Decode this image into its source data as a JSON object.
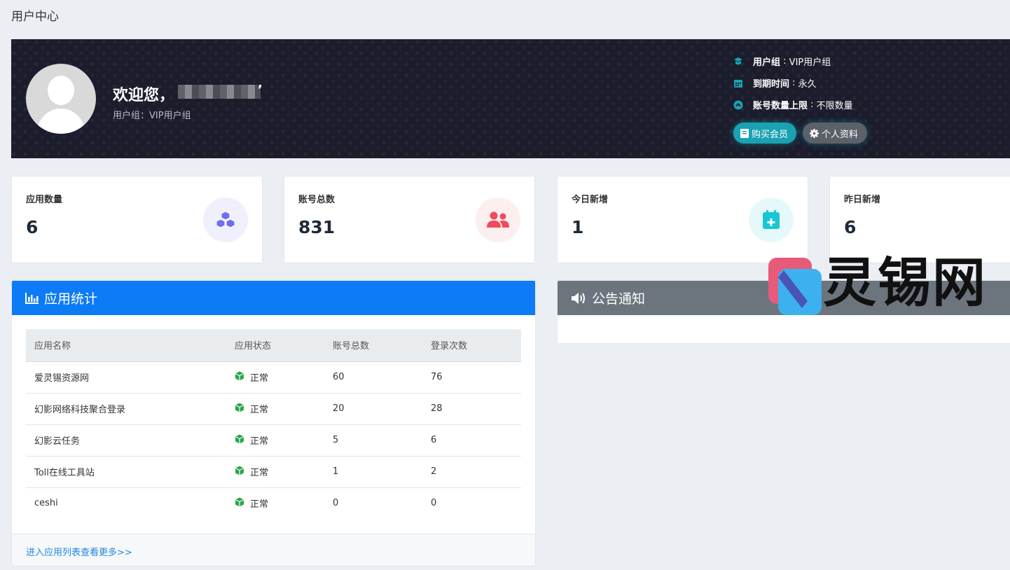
{
  "page": {
    "title": "用户中心"
  },
  "hero": {
    "welcome": "欢迎您，",
    "name_tail": "’",
    "usergroup_line": "用户组：VIP用户组",
    "info": [
      {
        "icon": "graduation-cap-icon",
        "label": "用户组",
        "sep": " : ",
        "value": "VIP用户组"
      },
      {
        "icon": "calendar-icon",
        "label": "到期时间",
        "sep": " : ",
        "value": "永久"
      },
      {
        "icon": "chevron-up-circle-icon",
        "label": "账号数量上限",
        "sep": " : ",
        "value": "不限数量"
      }
    ],
    "buttons": {
      "buy": "购买会员",
      "profile": "个人资料"
    }
  },
  "stats": [
    {
      "label": "应用数量",
      "value": "6",
      "icon": "cubes-icon",
      "color": "#6d6ff0",
      "bg": "#efeffd"
    },
    {
      "label": "账号总数",
      "value": "831",
      "icon": "users-icon",
      "color": "#ef4b5a",
      "bg": "#fdeeef"
    },
    {
      "label": "今日新增",
      "value": "1",
      "icon": "calendar-plus-icon",
      "color": "#19c6d6",
      "bg": "#e5f9fb"
    },
    {
      "label": "昨日新增",
      "value": "6"
    }
  ],
  "apps_panel": {
    "title": "应用统计",
    "columns": [
      "应用名称",
      "应用状态",
      "账号总数",
      "登录次数"
    ],
    "rows": [
      {
        "name": "爱灵锡资源网",
        "status": "正常",
        "accounts": "60",
        "logins": "76"
      },
      {
        "name": "幻影网络科技聚合登录",
        "status": "正常",
        "accounts": "20",
        "logins": "28"
      },
      {
        "name": "幻影云任务",
        "status": "正常",
        "accounts": "5",
        "logins": "6"
      },
      {
        "name": "Toll在线工具站",
        "status": "正常",
        "accounts": "1",
        "logins": "2"
      },
      {
        "name": "ceshi",
        "status": "正常",
        "accounts": "0",
        "logins": "0"
      }
    ],
    "more_link": "进入应用列表查看更多>>"
  },
  "notice_panel": {
    "title": "公告通知"
  },
  "watermark": {
    "text": "灵锡网"
  },
  "colors": {
    "primary": "#0d7bf5",
    "notice_header": "#6c757d",
    "hero_bg": "#1b1c2c",
    "success": "#28a745"
  }
}
